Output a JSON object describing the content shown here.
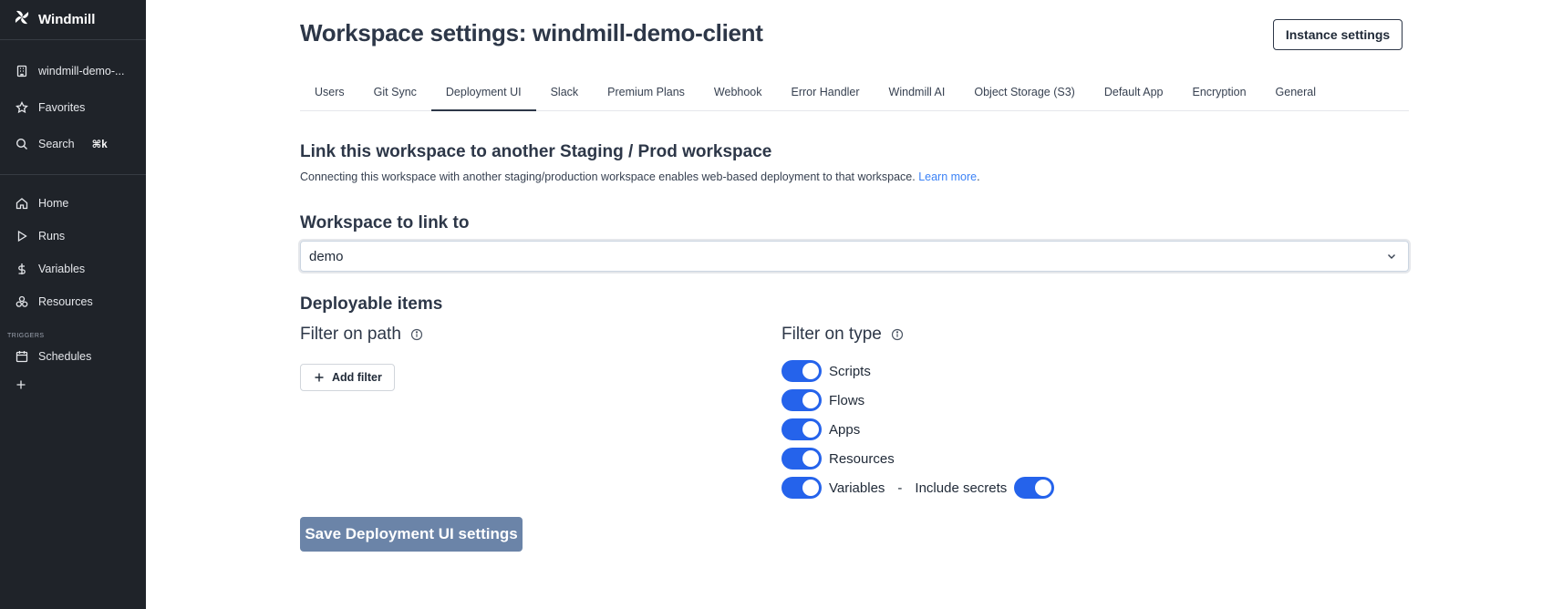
{
  "sidebar": {
    "brand": "Windmill",
    "workspace": "windmill-demo-...",
    "favorites": "Favorites",
    "search": "Search",
    "search_shortcut": "⌘k",
    "home": "Home",
    "runs": "Runs",
    "variables": "Variables",
    "resources": "Resources",
    "triggers_label": "TRIGGERS",
    "schedules": "Schedules"
  },
  "header": {
    "title": "Workspace settings: windmill-demo-client",
    "instance_settings": "Instance settings"
  },
  "tabs": [
    {
      "label": "Users"
    },
    {
      "label": "Git Sync"
    },
    {
      "label": "Deployment UI",
      "active": true
    },
    {
      "label": "Slack"
    },
    {
      "label": "Premium Plans"
    },
    {
      "label": "Webhook"
    },
    {
      "label": "Error Handler"
    },
    {
      "label": "Windmill AI"
    },
    {
      "label": "Object Storage (S3)"
    },
    {
      "label": "Default App"
    },
    {
      "label": "Encryption"
    },
    {
      "label": "General"
    }
  ],
  "link_section": {
    "heading": "Link this workspace to another Staging / Prod workspace",
    "description": "Connecting this workspace with another staging/production workspace enables web-based deployment to that workspace.",
    "learn_more": "Learn more",
    "period": "."
  },
  "workspace_link": {
    "heading": "Workspace to link to",
    "selected": "demo"
  },
  "deployable": {
    "heading": "Deployable items",
    "filter_path_heading": "Filter on path",
    "add_filter": "Add filter",
    "filter_type_heading": "Filter on type",
    "types": [
      {
        "label": "Scripts",
        "on": true
      },
      {
        "label": "Flows",
        "on": true
      },
      {
        "label": "Apps",
        "on": true
      },
      {
        "label": "Resources",
        "on": true
      },
      {
        "label": "Variables",
        "on": true
      }
    ],
    "dash": "-",
    "include_secrets": "Include secrets",
    "include_secrets_on": true
  },
  "save_button": "Save Deployment UI settings",
  "colors": {
    "sidebar_bg": "#1f2329",
    "toggle_on": "#2563eb",
    "link": "#3b82f6",
    "save_disabled": "#6b84a8"
  }
}
